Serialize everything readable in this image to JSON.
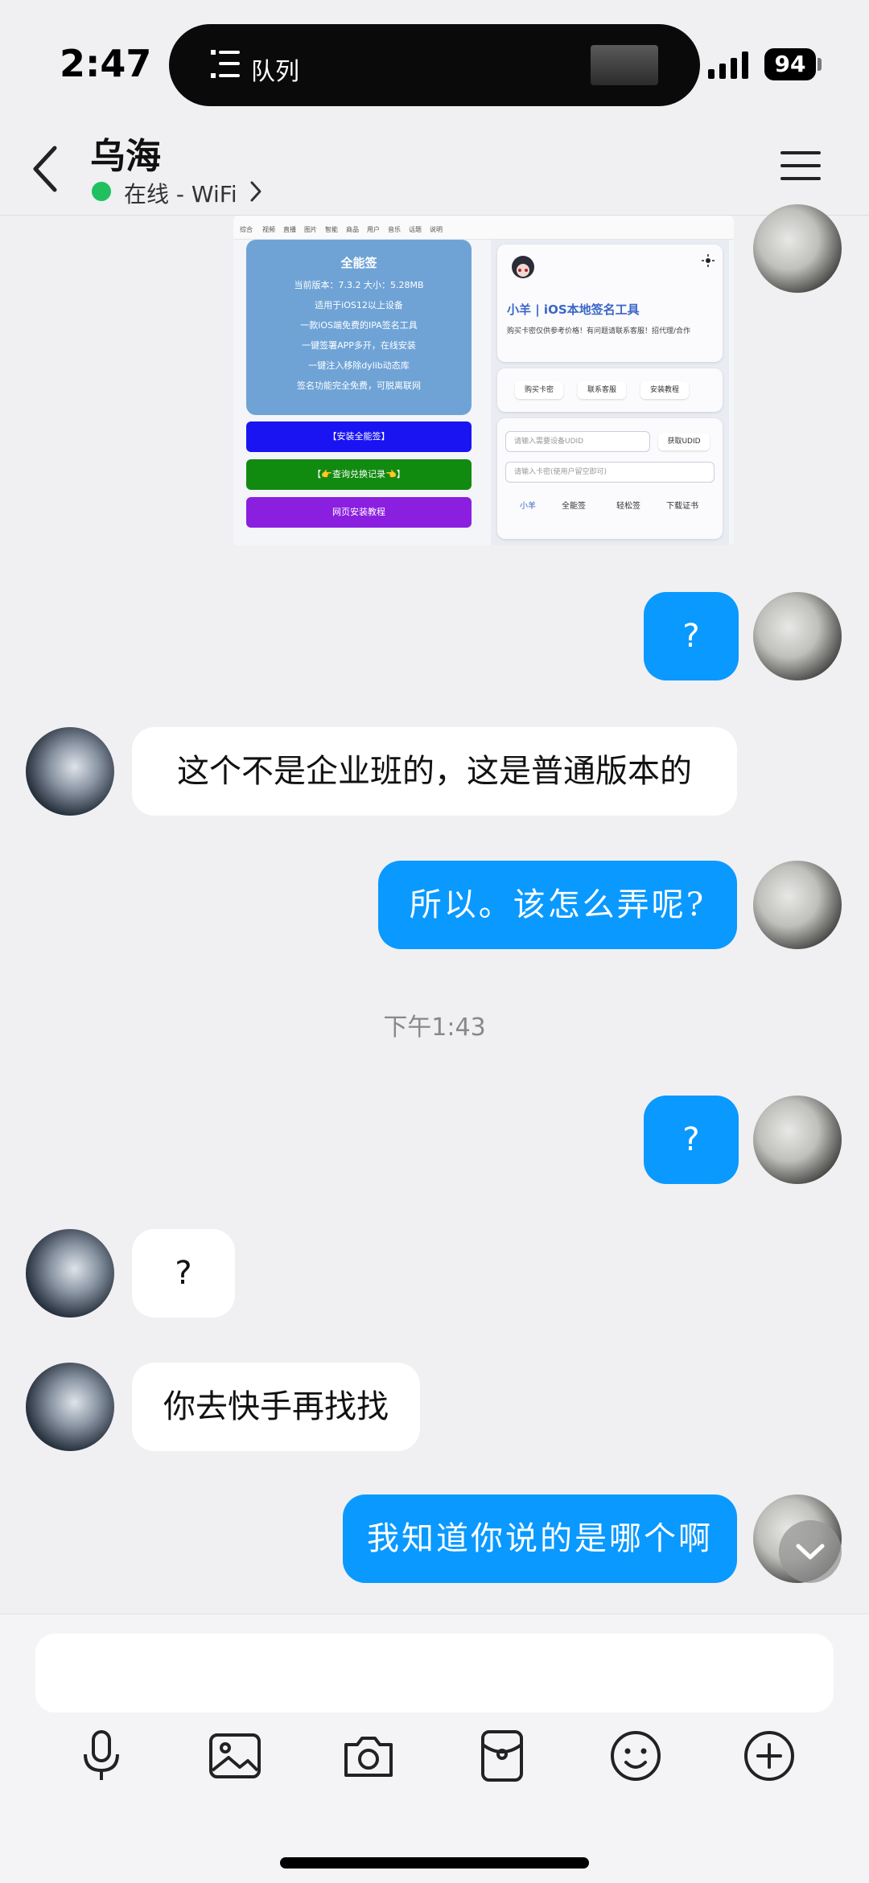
{
  "status_bar": {
    "time": "2:47",
    "island_label": "队列",
    "battery": "94"
  },
  "header": {
    "contact_name": "乌海",
    "online_status": "在线 - WiFi"
  },
  "shared_screenshot": {
    "tabs": [
      "综合",
      "视频",
      "直播",
      "图片",
      "智能",
      "商品",
      "用户",
      "音乐",
      "话题",
      "说明"
    ],
    "app_name": "全能签",
    "version_line": "当前版本：7.3.2   大小：5.28MB",
    "lines": [
      "适用于iOS12以上设备",
      "一款iOS端免费的IPA签名工具",
      "一键签署APP多开，在线安装",
      "一键注入移除dylib动态库",
      "签名功能完全免费，可脱离联网"
    ],
    "buttons": [
      {
        "label": "【安装全能签】",
        "color": "#1a14f2"
      },
      {
        "label": "【👉查询兑换记录👈】",
        "color": "#118a10"
      },
      {
        "label": "网页安装教程",
        "color": "#8a1fe0"
      }
    ],
    "right_title": "小羊 | iOS本地签名工具",
    "right_desc": "购买卡密仅供参考价格！有问题请联系客服！招代理/合作",
    "chips": [
      "购买卡密",
      "联系客服",
      "安装教程"
    ],
    "udid_placeholder": "请输入需要设备UDID",
    "get_udid": "获取UDID",
    "key_placeholder": "请输入卡密(使用户留空即可)",
    "bottom_tabs": [
      "小羊",
      "全能签",
      "轻松签",
      "下载证书"
    ]
  },
  "messages": [
    {
      "side": "mine",
      "text": "?"
    },
    {
      "side": "theirs",
      "text": "这个不是企业班的，这是普通版本的"
    },
    {
      "side": "mine",
      "text": "所以。该怎么弄呢?"
    },
    {
      "side": "mine",
      "text": "?"
    },
    {
      "side": "theirs",
      "text": "?"
    },
    {
      "side": "theirs",
      "text": "你去快手再找找"
    },
    {
      "side": "mine",
      "text": "我知道你说的是哪个啊"
    }
  ],
  "timestamp": "下午1:43",
  "colors": {
    "my_bubble": "#0a99ff",
    "their_bubble": "#ffffff",
    "online": "#20c060"
  },
  "toolbar_icons": [
    "microphone-icon",
    "image-icon",
    "camera-icon",
    "red-packet-icon",
    "emoji-icon",
    "plus-icon"
  ]
}
